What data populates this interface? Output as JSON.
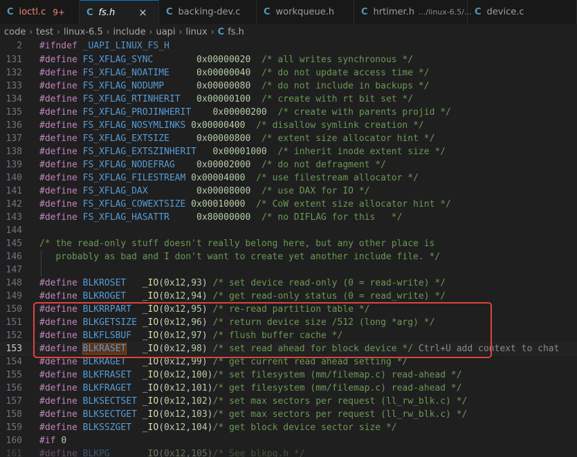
{
  "tabs": [
    {
      "icon": "C",
      "name": "ioctl.c",
      "badge": "9+",
      "active": false,
      "error": true
    },
    {
      "icon": "C",
      "name": "fs.h",
      "active": true,
      "close": "×"
    },
    {
      "icon": "C",
      "name": "backing-dev.c",
      "active": false
    },
    {
      "icon": "C",
      "name": "workqueue.h",
      "active": false
    },
    {
      "icon": "C",
      "name": "hrtimer.h",
      "desc": ".../linux-6.5/...",
      "active": false
    },
    {
      "icon": "C",
      "name": "device.c",
      "active": false
    }
  ],
  "breadcrumb": [
    "code",
    "test",
    "linux-6.5",
    "include",
    "uapi",
    "linux"
  ],
  "breadcrumb_file": {
    "icon": "C",
    "name": "fs.h"
  },
  "editor": {
    "current_line": "153",
    "inline_hint": "Ctrl+U add context to chat",
    "lines": [
      {
        "n": "2",
        "t": "#ifndef _UAPI_LINUX_FS_H"
      },
      {
        "n": "131",
        "t": "#define FS_XFLAG_SYNC        0x00000020  /* all writes synchronous */"
      },
      {
        "n": "132",
        "t": "#define FS_XFLAG_NOATIME     0x00000040  /* do not update access time */"
      },
      {
        "n": "133",
        "t": "#define FS_XFLAG_NODUMP      0x00000080  /* do not include in backups */"
      },
      {
        "n": "134",
        "t": "#define FS_XFLAG_RTINHERIT   0x00000100  /* create with rt bit set */"
      },
      {
        "n": "135",
        "t": "#define FS_XFLAG_PROJINHERIT    0x00000200  /* create with parents projid */"
      },
      {
        "n": "136",
        "t": "#define FS_XFLAG_NOSYMLINKS 0x00000400  /* disallow symlink creation */"
      },
      {
        "n": "137",
        "t": "#define FS_XFLAG_EXTSIZE     0x00000800  /* extent size allocator hint */"
      },
      {
        "n": "138",
        "t": "#define FS_XFLAG_EXTSZINHERIT   0x00001000  /* inherit inode extent size */"
      },
      {
        "n": "139",
        "t": "#define FS_XFLAG_NODEFRAG    0x00002000  /* do not defragment */"
      },
      {
        "n": "140",
        "t": "#define FS_XFLAG_FILESTREAM 0x00004000  /* use filestream allocator */"
      },
      {
        "n": "141",
        "t": "#define FS_XFLAG_DAX         0x00008000  /* use DAX for IO */"
      },
      {
        "n": "142",
        "t": "#define FS_XFLAG_COWEXTSIZE 0x00010000  /* CoW extent size allocator hint */"
      },
      {
        "n": "143",
        "t": "#define FS_XFLAG_HASATTR     0x80000000  /* no DIFLAG for this   */"
      },
      {
        "n": "144",
        "t": ""
      },
      {
        "n": "145",
        "t": "/* the read-only stuff doesn't really belong here, but any other place is"
      },
      {
        "n": "146",
        "t": "   probably as bad and I don't want to create yet another include file. */"
      },
      {
        "n": "147",
        "t": ""
      },
      {
        "n": "148",
        "t": "#define BLKROSET   _IO(0x12,93) /* set device read-only (0 = read-write) */"
      },
      {
        "n": "149",
        "t": "#define BLKROGET   _IO(0x12,94) /* get read-only status (0 = read_write) */"
      },
      {
        "n": "150",
        "t": "#define BLKRRPART  _IO(0x12,95) /* re-read partition table */"
      },
      {
        "n": "151",
        "t": "#define BLKGETSIZE _IO(0x12,96) /* return device size /512 (long *arg) */"
      },
      {
        "n": "152",
        "t": "#define BLKFLSBUF  _IO(0x12,97) /* flush buffer cache */"
      },
      {
        "n": "153",
        "t": "#define BLKRASET   _IO(0x12,98) /* set read ahead for block device */"
      },
      {
        "n": "154",
        "t": "#define BLKRAGET   _IO(0x12,99) /* get current read ahead setting */"
      },
      {
        "n": "155",
        "t": "#define BLKFRASET  _IO(0x12,100)/* set filesystem (mm/filemap.c) read-ahead */"
      },
      {
        "n": "156",
        "t": "#define BLKFRAGET  _IO(0x12,101)/* get filesystem (mm/filemap.c) read-ahead */"
      },
      {
        "n": "157",
        "t": "#define BLKSECTSET _IO(0x12,102)/* set max sectors per request (ll_rw_blk.c) */"
      },
      {
        "n": "158",
        "t": "#define BLKSECTGET _IO(0x12,103)/* get max sectors per request (ll_rw_blk.c) */"
      },
      {
        "n": "159",
        "t": "#define BLKSSZGET  _IO(0x12,104)/* get block device sector size */"
      },
      {
        "n": "160",
        "t": "#if 0"
      },
      {
        "n": "161",
        "t": "#define BLKPG      _IO(0x12,105)/* See blkpg.h */"
      }
    ]
  },
  "colors": {
    "selection_border": "#e0443e",
    "keyword": "#c586c0",
    "macro": "#569cd6",
    "number": "#b5cea8",
    "comment": "#6a9955"
  }
}
